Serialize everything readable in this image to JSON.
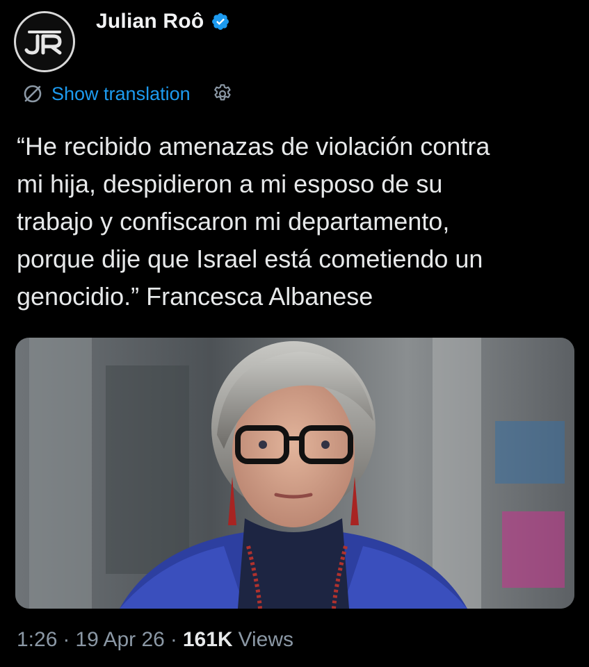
{
  "author": {
    "name": "Julian Roô",
    "avatar_text": "JR",
    "verified": true
  },
  "translation": {
    "label": "Show translation"
  },
  "tweet": {
    "text": "“He recibido amenazas de violación contra\nmi hija, despidieron a mi esposo de su\ntrabajo y confiscaron mi departamento,\nporque dije que Israel está cometiendo un\ngenocidio.” Francesca Albanese"
  },
  "meta": {
    "time": "1:26",
    "sep1": "·",
    "date": "19 Apr 26",
    "sep2": "·",
    "views_count": "161K",
    "views_label": "Views"
  },
  "colors": {
    "background": "#000000",
    "link": "#1d9bf0",
    "verified": "#1d9bf0",
    "secondary_text": "#8b98a5",
    "primary_text": "#e7e9ea"
  },
  "icons": {
    "verified": "verified-badge-icon",
    "translate": "translate-icon",
    "settings": "settings-gear-icon"
  }
}
